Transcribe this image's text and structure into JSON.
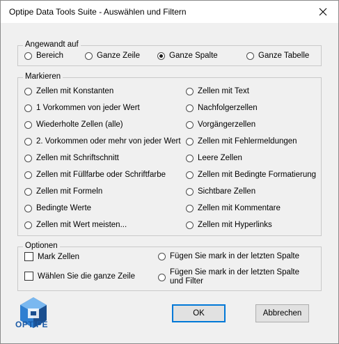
{
  "window": {
    "title": "Optipe Data Tools Suite - Auswählen und Filtern"
  },
  "applied_to": {
    "title": "Angewandt auf",
    "options": [
      {
        "label": "Bereich",
        "checked": false
      },
      {
        "label": "Ganze Zeile",
        "checked": false
      },
      {
        "label": "Ganze Spalte",
        "checked": true
      },
      {
        "label": "Ganze Tabelle",
        "checked": false
      }
    ]
  },
  "mark": {
    "title": "Markieren",
    "left": [
      "Zellen mit Konstanten",
      "1 Vorkommen von jeder Wert",
      "Wiederholte Zellen (alle)",
      "2. Vorkommen oder mehr von jeder Wert",
      "Zellen mit Schriftschnitt",
      "Zellen mit Füllfarbe oder Schriftfarbe",
      "Zellen mit Formeln",
      "Bedingte Werte",
      "Zellen mit Wert meisten..."
    ],
    "right": [
      "Zellen mit Text",
      "Nachfolgerzellen",
      "Vorgängerzellen",
      "Zellen mit Fehlermeldungen",
      "Leere Zellen",
      "Zellen mit Bedingte Formatierung",
      "Sichtbare Zellen",
      "Zellen mit Kommentare",
      "Zellen mit Hyperlinks"
    ]
  },
  "options": {
    "title": "Optionen",
    "mark_cells": "Mark Zellen",
    "select_whole_row": "Wählen Sie die ganze Zeile",
    "add_mark_last_column": "Fügen Sie mark in der letzten Spalte",
    "add_mark_last_column_filter": "Fügen Sie mark in der letzten Spalte und Filter"
  },
  "buttons": {
    "ok": "OK",
    "cancel": "Abbrechen"
  },
  "brand": {
    "name": "OPTIPE",
    "colors": {
      "dark": "#1b4f8f",
      "mid": "#2f7fd1",
      "light": "#7ab8f0"
    }
  }
}
